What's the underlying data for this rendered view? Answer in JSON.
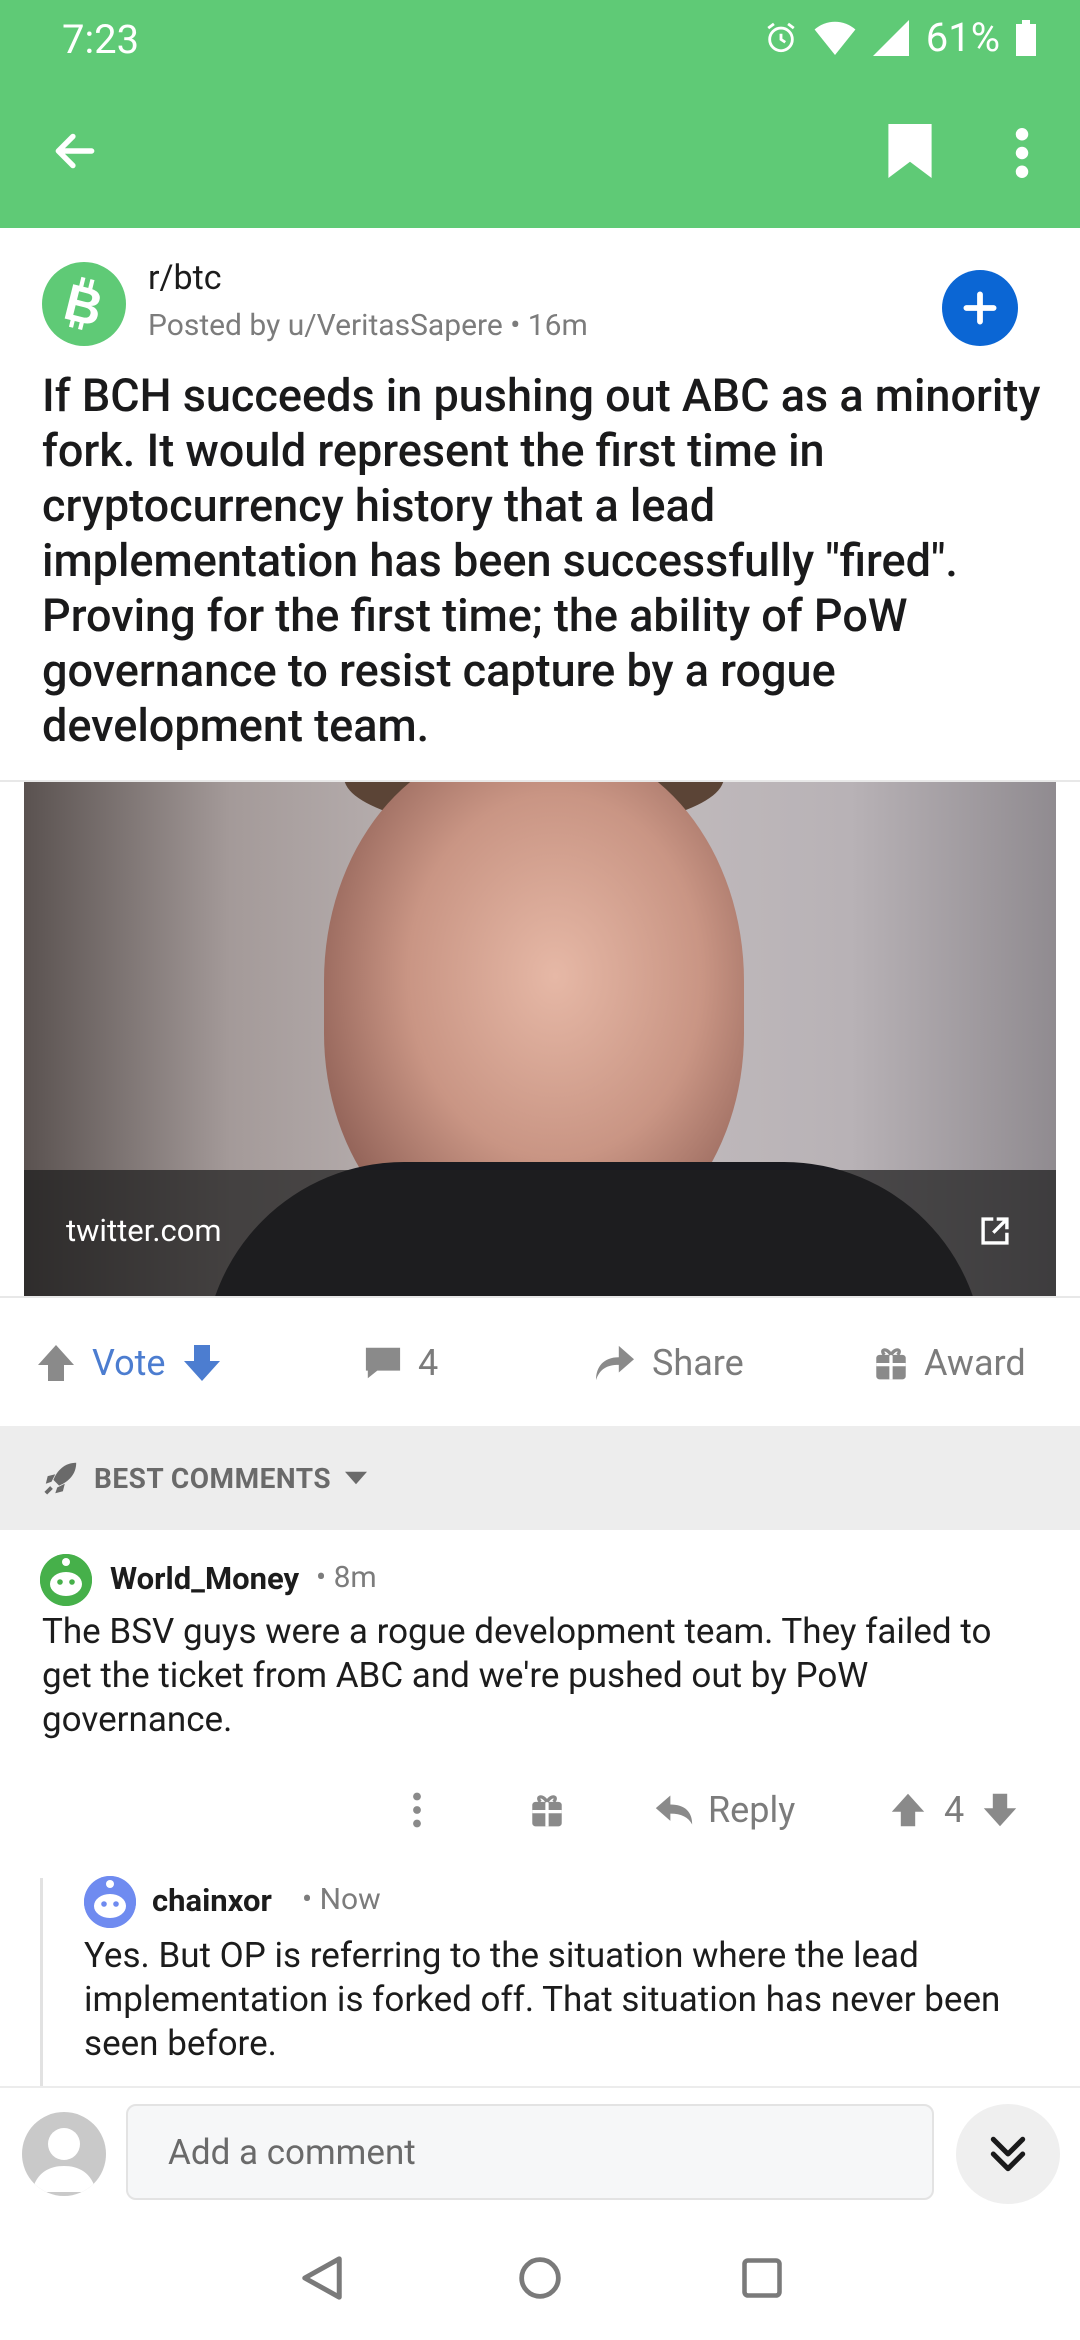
{
  "status_bar": {
    "time": "7:23",
    "battery": "61%"
  },
  "app_bar": {
    "back_icon": "arrow-left-icon",
    "bookmark_icon": "bookmark-icon",
    "menu_icon": "more-vertical-icon",
    "color": "#5fca76"
  },
  "post": {
    "subreddit": "r/btc",
    "meta": "Posted by u/VeritasSapere • 16m",
    "title": "If BCH succeeds in pushing out ABC as a minority fork. It would represent the first time in cryptocurrency history that a lead implementation has been successfully \"fired\". Proving for the first time; the ability of PoW governance to resist capture by a rogue development team.",
    "link_domain": "twitter.com",
    "join_color": "#0b66d4"
  },
  "actions": {
    "vote_label": "Vote",
    "comment_count": "4",
    "share_label": "Share",
    "award_label": "Award"
  },
  "sort": {
    "label": "BEST COMMENTS"
  },
  "comments": [
    {
      "user": "World_Money",
      "time": "• 8m",
      "body": "The BSV guys were a rogue development team. They failed to get the ticket from ABC and we're pushed out by PoW governance.",
      "reply_label": "Reply",
      "score": "4"
    },
    {
      "user": "chainxor",
      "time": "• Now",
      "body": "Yes. But OP is referring to the situation where the lead implementation is forked off. That situation has never been seen before."
    }
  ],
  "composer": {
    "placeholder": "Add a comment"
  }
}
